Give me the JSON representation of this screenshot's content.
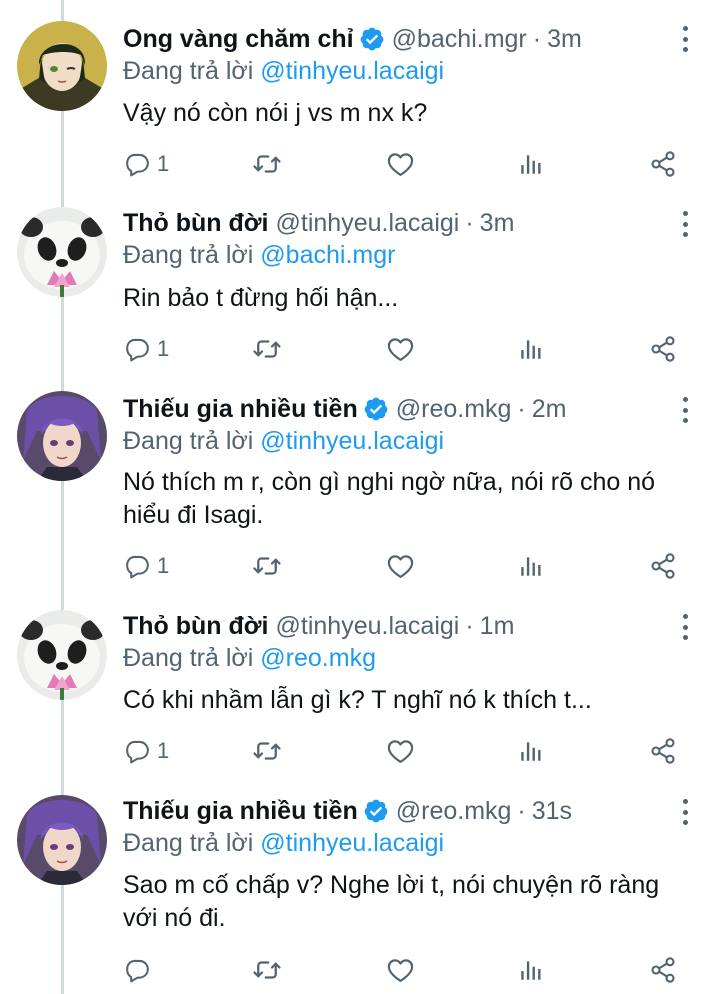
{
  "colors": {
    "accent": "#1d9bf0",
    "muted": "#536471",
    "text": "#0f1419",
    "thread_line": "#cfd9de"
  },
  "icons": {
    "reply": "reply-icon",
    "retweet": "retweet-icon",
    "like": "heart-icon",
    "views": "analytics-icon",
    "share": "share-icon",
    "more": "more-icon",
    "verified": "verified-badge-icon"
  },
  "tweets": [
    {
      "name": "Ong vàng chăm chỉ",
      "verified": true,
      "handle": "@bachi.mgr",
      "time": "3m",
      "reply_prefix": "Đang trả lời",
      "reply_to": "@tinhyeu.lacaigi",
      "text": "Vậy nó còn nói j vs m nx k?",
      "reply_count": "1"
    },
    {
      "name": "Thỏ bùn đời",
      "verified": false,
      "handle": "@tinhyeu.lacaigi",
      "time": "3m",
      "reply_prefix": "Đang trả lời",
      "reply_to": "@bachi.mgr",
      "text": "Rin bảo t đừng hối hận...",
      "reply_count": "1"
    },
    {
      "name": "Thiếu gia nhiều tiền",
      "verified": true,
      "handle": "@reo.mkg",
      "time": "2m",
      "reply_prefix": "Đang trả lời",
      "reply_to": "@tinhyeu.lacaigi",
      "text": "Nó thích m r, còn gì nghi ngờ nữa, nói rõ cho nó hiểu đi Isagi.",
      "reply_count": "1"
    },
    {
      "name": "Thỏ bùn đời",
      "verified": false,
      "handle": "@tinhyeu.lacaigi",
      "time": "1m",
      "reply_prefix": "Đang trả lời",
      "reply_to": "@reo.mkg",
      "text": "Có khi nhầm lẫn gì k? T nghĩ nó k thích t...",
      "reply_count": "1"
    },
    {
      "name": "Thiếu gia nhiều tiền",
      "verified": true,
      "handle": "@reo.mkg",
      "time": "31s",
      "reply_prefix": "Đang trả lời",
      "reply_to": "@tinhyeu.lacaigi",
      "text": "Sao m cố chấp v? Nghe lời t, nói chuyện rõ ràng với nó đi.",
      "reply_count": ""
    }
  ]
}
